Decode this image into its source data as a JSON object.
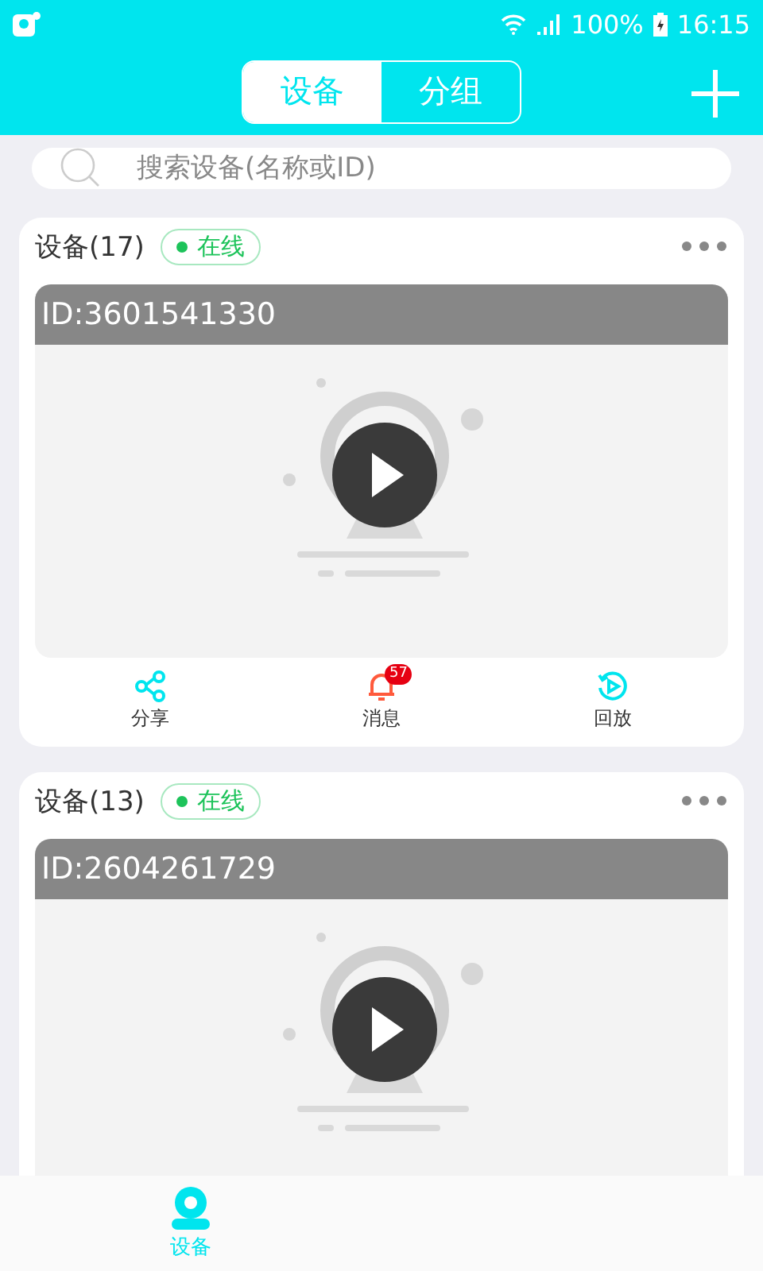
{
  "status_bar": {
    "battery": "100%",
    "time": "16:15"
  },
  "header": {
    "tabs": [
      {
        "label": "设备",
        "selected": true
      },
      {
        "label": "分组",
        "selected": false
      }
    ]
  },
  "search": {
    "placeholder": "搜索设备(名称或ID)"
  },
  "devices": [
    {
      "name": "设备(17)",
      "status": "在线",
      "online": true,
      "id": "ID:3601541330",
      "actions": [
        {
          "kind": "share",
          "label": "分享"
        },
        {
          "kind": "message",
          "label": "消息",
          "badge": "57"
        },
        {
          "kind": "playback",
          "label": "回放"
        }
      ]
    },
    {
      "name": "设备(13)",
      "status": "在线",
      "online": true,
      "id": "ID:2604261729"
    }
  ],
  "bottom_nav": [
    {
      "label": "设备",
      "selected": true
    }
  ]
}
